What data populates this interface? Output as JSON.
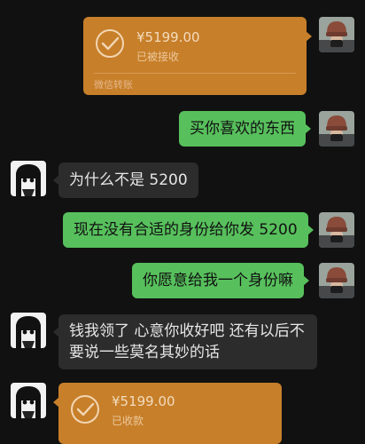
{
  "messages": {
    "transfer1": {
      "amount": "¥5199.00",
      "status": "已被接收",
      "footer": "微信转账"
    },
    "m1": "买你喜欢的东西",
    "m2": "为什么不是 5200",
    "m3": "现在没有合适的身份给你发 5200",
    "m4": "你愿意给我一个身份嘛",
    "m5_line1": "钱我领了 心意你收好吧 还有以后不",
    "m5_line2": "要说一些莫名其妙的话",
    "transfer2": {
      "amount": "¥5199.00",
      "status": "已收款"
    }
  },
  "colors": {
    "background": "#111111",
    "green_bubble": "#57c05c",
    "grey_bubble": "#2c2c2c",
    "transfer": "#c77f2a"
  },
  "icons": {
    "check": "check-circle-icon",
    "self_avatar": "helmet-avatar",
    "other_avatar": "anime-girl-avatar"
  }
}
